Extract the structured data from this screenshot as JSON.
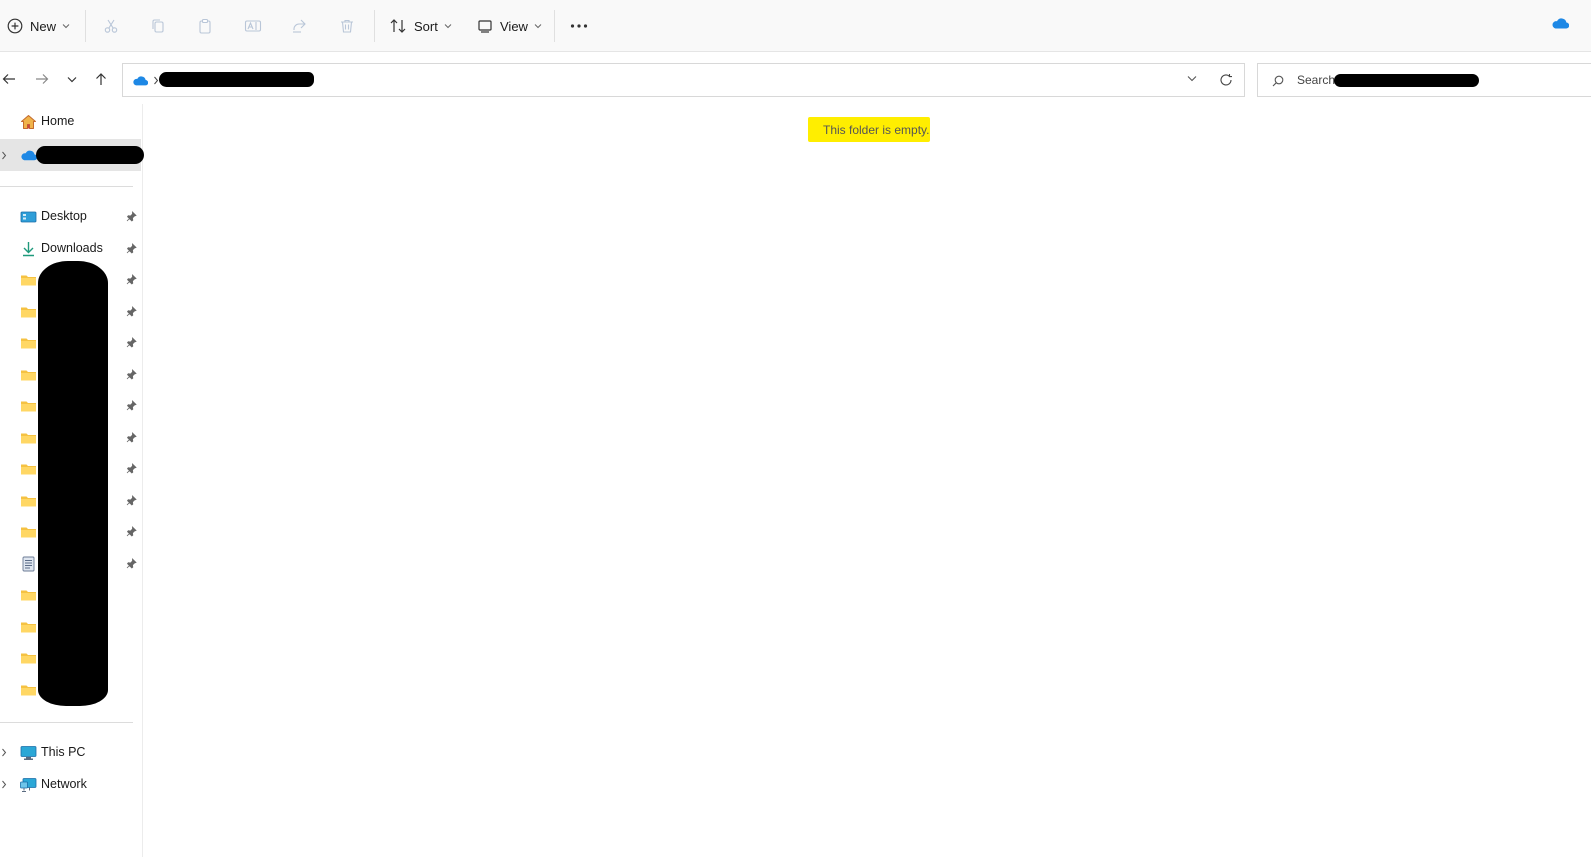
{
  "toolbar": {
    "new_label": "New",
    "sort_label": "Sort",
    "view_label": "View",
    "icons": [
      "plus-circle-icon",
      "scissors-icon",
      "copy-icon",
      "paste-icon",
      "rename-icon",
      "share-icon",
      "delete-icon",
      "sort-icon",
      "view-icon",
      "more-icon",
      "onedrive-icon"
    ]
  },
  "address": {
    "location_icon": "onedrive-icon",
    "path_redacted": true
  },
  "search": {
    "placeholder": "Search"
  },
  "nav": {
    "home": "Home",
    "desktop": "Desktop",
    "downloads": "Downloads",
    "this_pc": "This PC",
    "network": "Network"
  },
  "content": {
    "empty_message": "This folder is empty."
  },
  "colors": {
    "highlight": "#ffee00",
    "onedrive": "#1e88e5",
    "folder": "#f5c242",
    "redaction": "#000000"
  }
}
